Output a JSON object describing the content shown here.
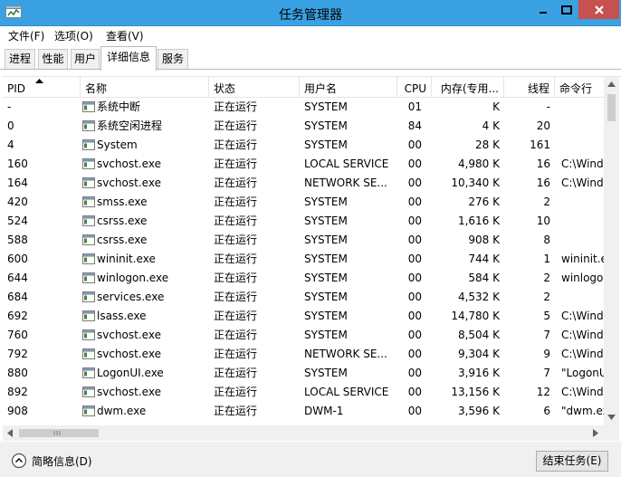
{
  "window": {
    "title": "任务管理器",
    "icon": "task-manager-icon",
    "accent_color": "#3aa1e2",
    "close_color": "#c75050"
  },
  "menu": [
    "文件(F)",
    "选项(O)",
    "查看(V)"
  ],
  "tabs": [
    {
      "label": "进程",
      "active": false
    },
    {
      "label": "性能",
      "active": false
    },
    {
      "label": "用户",
      "active": false
    },
    {
      "label": "详细信息",
      "active": true
    },
    {
      "label": "服务",
      "active": false
    }
  ],
  "columns": [
    "PID",
    "名称",
    "状态",
    "用户名",
    "CPU",
    "内存(专用...",
    "线程",
    "命令行"
  ],
  "sort": {
    "column": "PID",
    "direction": "ascending"
  },
  "processes": [
    {
      "pid": "-",
      "name": "系统中断",
      "status": "正在运行",
      "user": "SYSTEM",
      "cpu": "01",
      "mem": "K",
      "threads": "-",
      "cmd": ""
    },
    {
      "pid": "0",
      "name": "系统空闲进程",
      "status": "正在运行",
      "user": "SYSTEM",
      "cpu": "84",
      "mem": "4 K",
      "threads": "20",
      "cmd": ""
    },
    {
      "pid": "4",
      "name": "System",
      "status": "正在运行",
      "user": "SYSTEM",
      "cpu": "00",
      "mem": "28 K",
      "threads": "161",
      "cmd": ""
    },
    {
      "pid": "160",
      "name": "svchost.exe",
      "status": "正在运行",
      "user": "LOCAL SERVICE",
      "cpu": "00",
      "mem": "4,980 K",
      "threads": "16",
      "cmd": "C:\\Windo"
    },
    {
      "pid": "164",
      "name": "svchost.exe",
      "status": "正在运行",
      "user": "NETWORK SE...",
      "cpu": "00",
      "mem": "10,340 K",
      "threads": "16",
      "cmd": "C:\\Windo"
    },
    {
      "pid": "420",
      "name": "smss.exe",
      "status": "正在运行",
      "user": "SYSTEM",
      "cpu": "00",
      "mem": "276 K",
      "threads": "2",
      "cmd": ""
    },
    {
      "pid": "524",
      "name": "csrss.exe",
      "status": "正在运行",
      "user": "SYSTEM",
      "cpu": "00",
      "mem": "1,616 K",
      "threads": "10",
      "cmd": ""
    },
    {
      "pid": "588",
      "name": "csrss.exe",
      "status": "正在运行",
      "user": "SYSTEM",
      "cpu": "00",
      "mem": "908 K",
      "threads": "8",
      "cmd": ""
    },
    {
      "pid": "600",
      "name": "wininit.exe",
      "status": "正在运行",
      "user": "SYSTEM",
      "cpu": "00",
      "mem": "744 K",
      "threads": "1",
      "cmd": "wininit.ex"
    },
    {
      "pid": "644",
      "name": "winlogon.exe",
      "status": "正在运行",
      "user": "SYSTEM",
      "cpu": "00",
      "mem": "584 K",
      "threads": "2",
      "cmd": "winlogon"
    },
    {
      "pid": "684",
      "name": "services.exe",
      "status": "正在运行",
      "user": "SYSTEM",
      "cpu": "00",
      "mem": "4,532 K",
      "threads": "2",
      "cmd": ""
    },
    {
      "pid": "692",
      "name": "lsass.exe",
      "status": "正在运行",
      "user": "SYSTEM",
      "cpu": "00",
      "mem": "14,780 K",
      "threads": "5",
      "cmd": "C:\\Windo"
    },
    {
      "pid": "760",
      "name": "svchost.exe",
      "status": "正在运行",
      "user": "SYSTEM",
      "cpu": "00",
      "mem": "8,504 K",
      "threads": "7",
      "cmd": "C:\\Windo"
    },
    {
      "pid": "792",
      "name": "svchost.exe",
      "status": "正在运行",
      "user": "NETWORK SE...",
      "cpu": "00",
      "mem": "9,304 K",
      "threads": "9",
      "cmd": "C:\\Windo"
    },
    {
      "pid": "880",
      "name": "LogonUI.exe",
      "status": "正在运行",
      "user": "SYSTEM",
      "cpu": "00",
      "mem": "3,916 K",
      "threads": "7",
      "cmd": "\"LogonU"
    },
    {
      "pid": "892",
      "name": "svchost.exe",
      "status": "正在运行",
      "user": "LOCAL SERVICE",
      "cpu": "00",
      "mem": "13,156 K",
      "threads": "12",
      "cmd": "C:\\Windo"
    },
    {
      "pid": "908",
      "name": "dwm.exe",
      "status": "正在运行",
      "user": "DWM-1",
      "cpu": "00",
      "mem": "3,596 K",
      "threads": "6",
      "cmd": "\"dwm.ex"
    }
  ],
  "footer": {
    "less_details_label": "简略信息(D)",
    "end_task_label": "结束任务(E)"
  }
}
